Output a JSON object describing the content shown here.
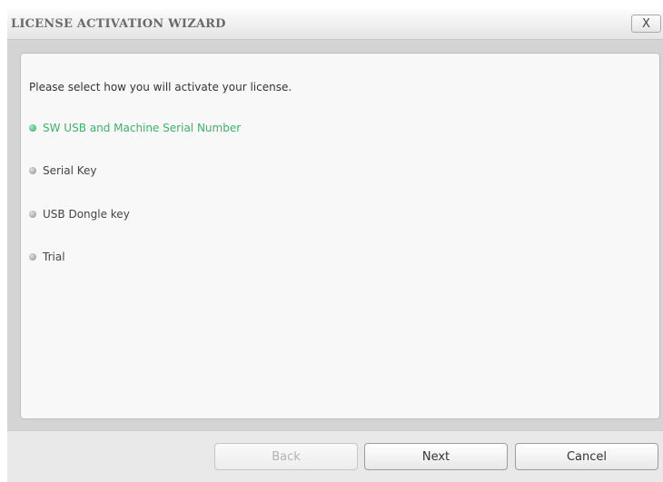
{
  "window": {
    "title": "LICENSE ACTIVATION WIZARD",
    "close_label": "X"
  },
  "content": {
    "prompt": "Please select how you will activate your license.",
    "options": [
      {
        "label": "SW USB and Machine Serial Number",
        "selected": true
      },
      {
        "label": "Serial Key",
        "selected": false
      },
      {
        "label": "USB Dongle key",
        "selected": false
      },
      {
        "label": "Trial",
        "selected": false
      }
    ]
  },
  "footer": {
    "back_label": "Back",
    "back_enabled": false,
    "next_label": "Next",
    "cancel_label": "Cancel"
  },
  "colors": {
    "selected_option": "#3cb36a",
    "window_background": "#d4d4d4",
    "panel_background": "#f8f8f8"
  }
}
